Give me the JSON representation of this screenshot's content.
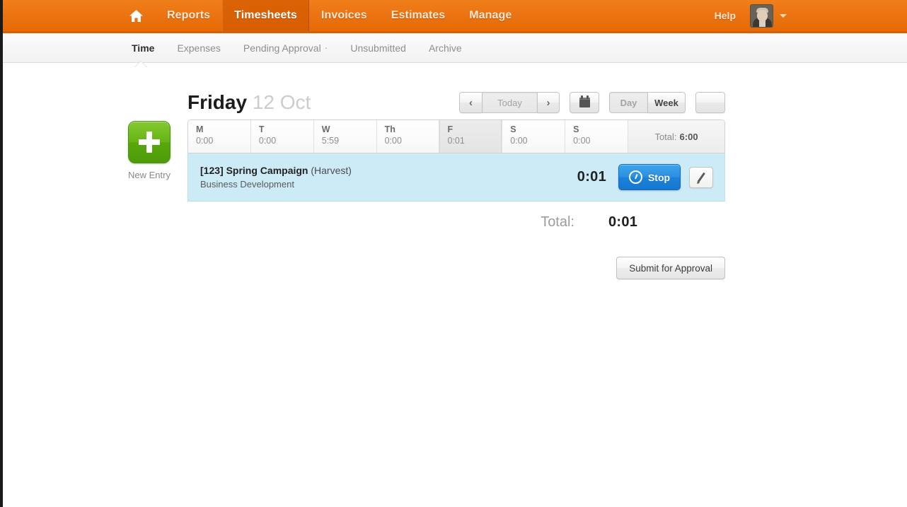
{
  "topnav": {
    "home_icon": "home-icon",
    "items": [
      {
        "label": "Reports",
        "active": false
      },
      {
        "label": "Timesheets",
        "active": true
      },
      {
        "label": "Invoices",
        "active": false
      },
      {
        "label": "Estimates",
        "active": false
      },
      {
        "label": "Manage",
        "active": false
      }
    ],
    "help_label": "Help",
    "avatar_alt": "user-avatar",
    "accent_color": "#e66a05",
    "active_tab_color": "#d85e02"
  },
  "subnav": {
    "items": [
      {
        "label": "Time",
        "active": true,
        "marker": ""
      },
      {
        "label": "Expenses",
        "active": false,
        "marker": ""
      },
      {
        "label": "Pending Approval",
        "active": false,
        "marker": "·"
      },
      {
        "label": "Unsubmitted",
        "active": false,
        "marker": ""
      },
      {
        "label": "Archive",
        "active": false,
        "marker": ""
      }
    ]
  },
  "header": {
    "day_name": "Friday",
    "date_label": "12 Oct",
    "prev_label": "‹",
    "today_label": "Today",
    "next_label": "›",
    "calendar_icon": "calendar-icon",
    "day_label": "Day",
    "week_label": "Week",
    "people_icon": "people-icon"
  },
  "new_entry": {
    "label": "New Entry",
    "icon": "plus-icon",
    "color": "#5fb213"
  },
  "week": {
    "days": [
      {
        "abbr": "M",
        "hours": "0:00",
        "selected": false
      },
      {
        "abbr": "T",
        "hours": "0:00",
        "selected": false
      },
      {
        "abbr": "W",
        "hours": "5:59",
        "selected": false
      },
      {
        "abbr": "Th",
        "hours": "0:00",
        "selected": false
      },
      {
        "abbr": "F",
        "hours": "0:01",
        "selected": true
      },
      {
        "abbr": "S",
        "hours": "0:00",
        "selected": false
      },
      {
        "abbr": "S",
        "hours": "0:00",
        "selected": false
      }
    ],
    "total_label": "Total:",
    "total_value": "6:00"
  },
  "entry": {
    "code": "[123] Spring Campaign",
    "client": "(Harvest)",
    "task": "Business Development",
    "hours": "0:01",
    "stop_label": "Stop",
    "stop_icon": "timer-icon",
    "edit_icon": "pencil-icon",
    "row_color": "#cdeaf7",
    "stop_color": "#1c82d9"
  },
  "totals": {
    "label": "Total:",
    "value": "0:01"
  },
  "submit": {
    "label": "Submit for Approval"
  }
}
